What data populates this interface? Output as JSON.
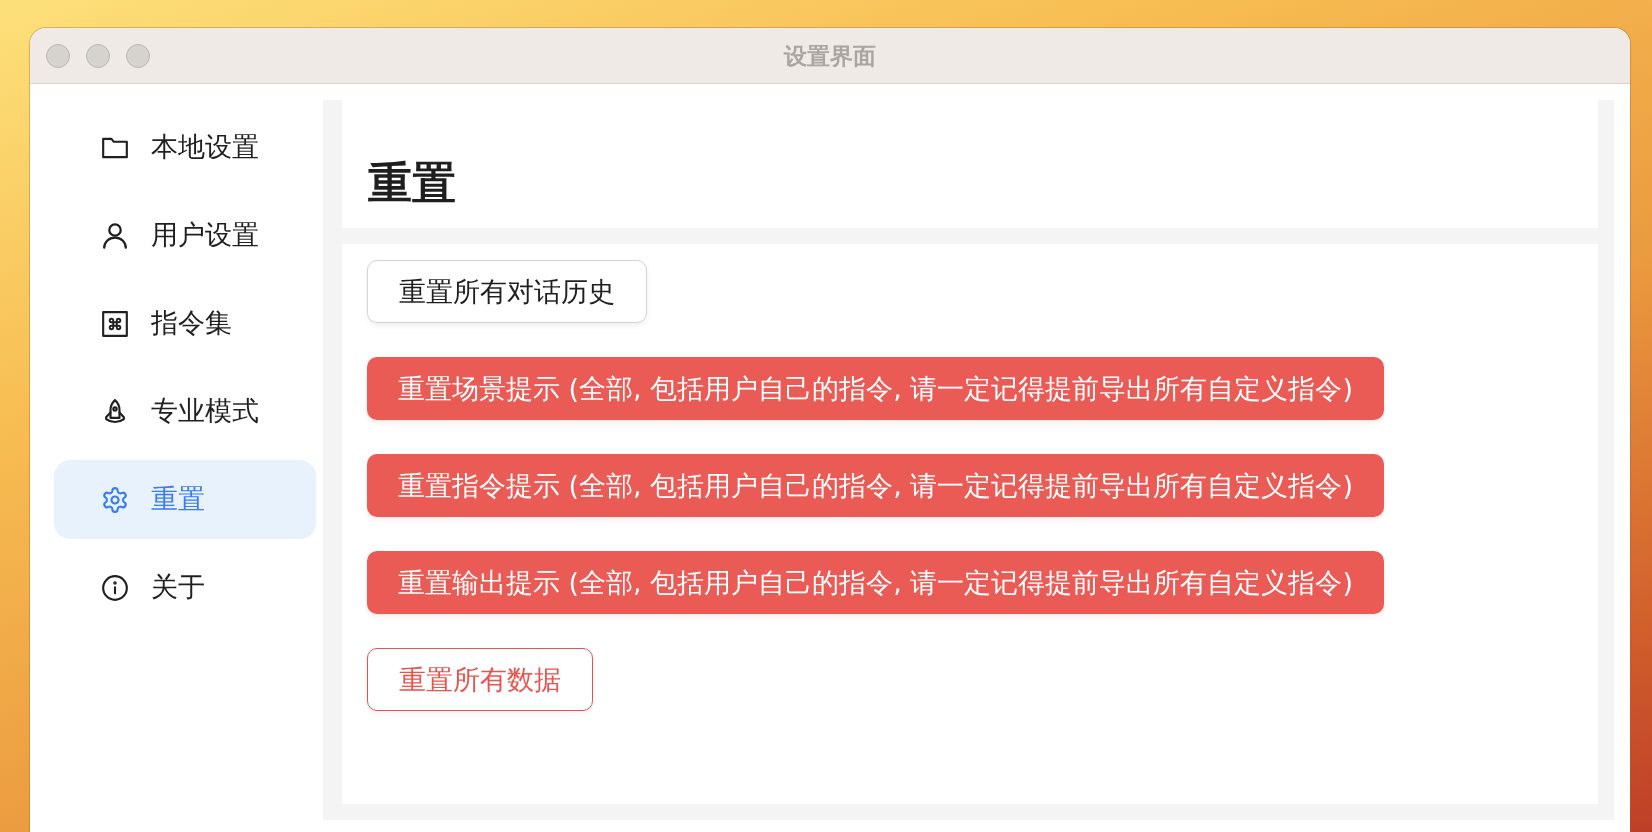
{
  "window": {
    "title": "设置界面"
  },
  "sidebar": {
    "items": [
      {
        "label": "本地设置",
        "selected": false
      },
      {
        "label": "用户设置",
        "selected": false
      },
      {
        "label": "指令集",
        "selected": false
      },
      {
        "label": "专业模式",
        "selected": false
      },
      {
        "label": "重置",
        "selected": true
      },
      {
        "label": "关于",
        "selected": false
      }
    ]
  },
  "main": {
    "heading": "重置",
    "actions": [
      {
        "label": "重置所有对话历史",
        "kind": "default"
      },
      {
        "label": "重置场景提示 (全部, 包括用户自己的指令, 请一定记得提前导出所有自定义指令)",
        "kind": "danger"
      },
      {
        "label": "重置指令提示 (全部, 包括用户自己的指令, 请一定记得提前导出所有自定义指令)",
        "kind": "danger"
      },
      {
        "label": "重置输出提示 (全部, 包括用户自己的指令, 请一定记得提前导出所有自定义指令)",
        "kind": "danger"
      },
      {
        "label": "重置所有数据",
        "kind": "outline"
      }
    ]
  }
}
